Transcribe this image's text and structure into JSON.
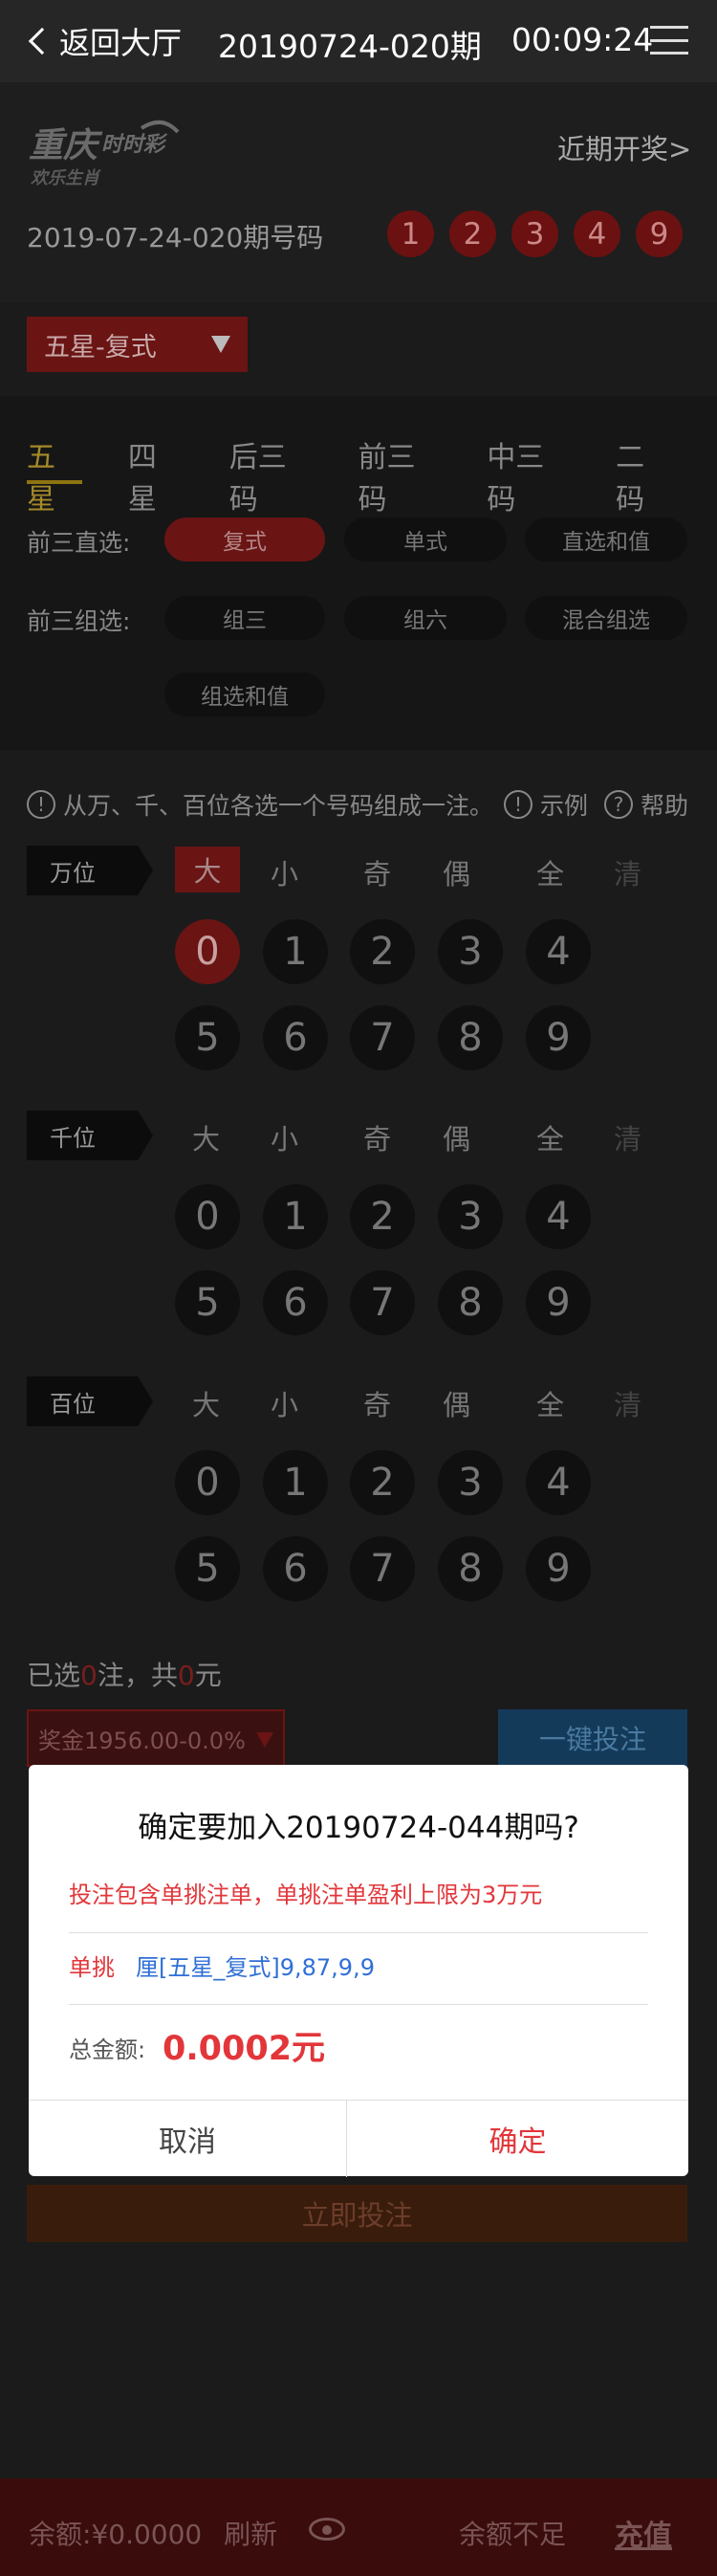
{
  "header": {
    "back_label": "返回大厅",
    "period": "20190724-020期",
    "timer": "00:09:24"
  },
  "lottery": {
    "logo_main": "重庆",
    "logo_accent": "时时彩",
    "logo_sub": "欢乐生肖",
    "recent_label": "近期开奖>",
    "draw_label": "2019-07-24-020期号码",
    "balls": [
      "1",
      "2",
      "3",
      "4",
      "9"
    ]
  },
  "play_type": "五星-复式",
  "tabs": [
    "五星",
    "四星",
    "后三码",
    "前三码",
    "中三码",
    "二码"
  ],
  "direct_row": {
    "label": "前三直选:",
    "options": [
      "复式",
      "单式",
      "直选和值"
    ]
  },
  "group_row": {
    "label": "前三组选:",
    "options": [
      "组三",
      "组六",
      "混合组选",
      "组选和值"
    ]
  },
  "hints": {
    "main": "从万、千、百位各选一个号码组成一注。",
    "example": "示例",
    "help": "帮助"
  },
  "filters": [
    "大",
    "小",
    "奇",
    "偶",
    "全",
    "清"
  ],
  "positions": [
    {
      "label": "万位",
      "row1": [
        "0",
        "1",
        "2",
        "3",
        "4"
      ],
      "row2": [
        "5",
        "6",
        "7",
        "8",
        "9"
      ]
    },
    {
      "label": "千位",
      "row1": [
        "0",
        "1",
        "2",
        "3",
        "4"
      ],
      "row2": [
        "5",
        "6",
        "7",
        "8",
        "9"
      ]
    },
    {
      "label": "百位",
      "row1": [
        "0",
        "1",
        "2",
        "3",
        "4"
      ],
      "row2": [
        "5",
        "6",
        "7",
        "8",
        "9"
      ]
    }
  ],
  "summary": {
    "prefix": "已选",
    "count": "0",
    "mid": "注，共",
    "amount": "0",
    "suffix": "元"
  },
  "bonus": "奖金1956.00-0.0%",
  "one_key": "一键投注",
  "submit": "立即投注",
  "bottom": {
    "balance_label": "余额:",
    "balance_value": "¥0.0000",
    "refresh": "刷新",
    "insufficient": "余额不足",
    "charge": "充值"
  },
  "modal": {
    "title": "确定要加入20190724-044期吗?",
    "warning": "投注包含单挑注单，单挑注单盈利上限为3万元",
    "single_label": "单挑",
    "detail": "厘[五星_复式]9,87,9,9",
    "total_label": "总金额:",
    "total_value": "0.0002元",
    "cancel": "取消",
    "confirm": "确定"
  },
  "colors": {
    "accent_red": "#e2363a",
    "link_blue": "#2f6fd6",
    "gold": "#a58a2a"
  }
}
